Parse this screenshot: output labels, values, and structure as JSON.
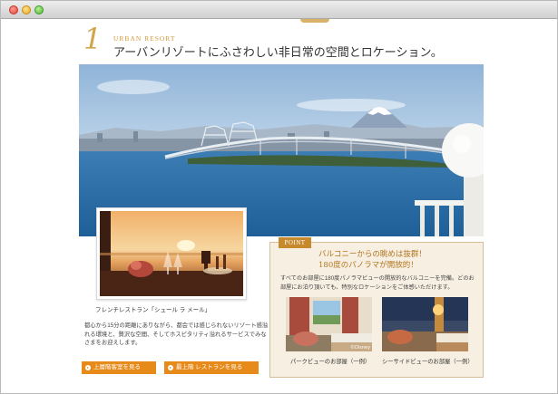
{
  "window": {
    "traffic_lights": [
      "close",
      "minimize",
      "zoom"
    ]
  },
  "section": {
    "number": "1",
    "subtitle": "URBAN RESORT",
    "title": "アーバンリゾートにふさわしい非日常の空間とロケーション。"
  },
  "restaurant": {
    "caption": "フレンチレストラン「シュール ラ メール」",
    "body": "都心から15分の距離にありながら、都会では感じられないリゾート感溢れる環境と、贅沢な空間、そしてホスピタリティ溢れるサービスでみなさまをお迎えします。"
  },
  "buttons": [
    {
      "label": "上層階客室を見る"
    },
    {
      "label": "最上階 レストランを見る"
    }
  ],
  "point": {
    "badge": "POINT",
    "title_line1": "バルコニーからの眺めは抜群！",
    "title_line2": "180度のパノラマが開放的！",
    "text": "すべてのお部屋に180度パノラマビューの開放的なバルコニーを完備。どのお部屋にお泊り頂いても、特別なロケーションをご体感いただけます。",
    "rooms": [
      {
        "caption": "パークビューのお部屋（一例）",
        "watermark": "©Disney"
      },
      {
        "caption": "シーサイドビューのお部屋（一例）"
      }
    ]
  },
  "colors": {
    "accent": "#d3a54a",
    "button": "#e68a1a",
    "badge": "#c68a2d",
    "point_bg": "#f7efe2"
  }
}
